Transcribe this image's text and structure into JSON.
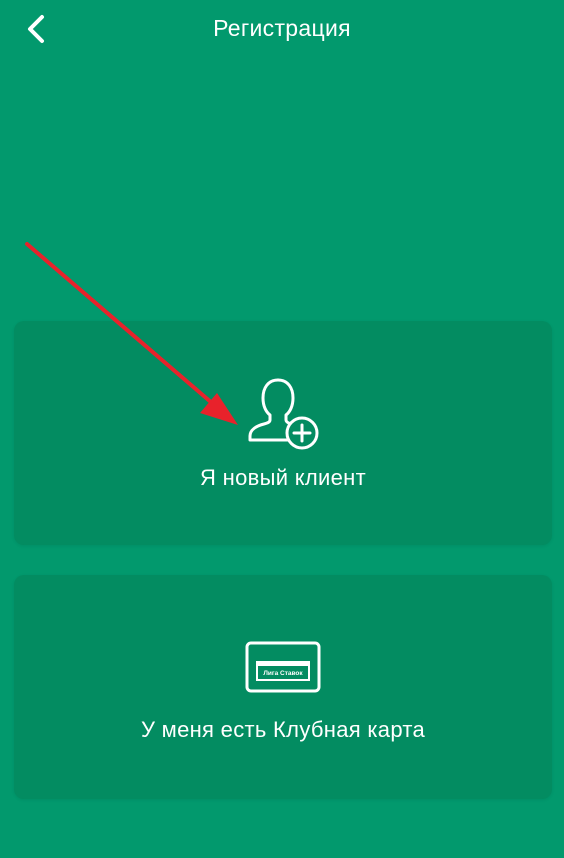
{
  "header": {
    "title": "Регистрация",
    "back_icon": "chevron-left-icon"
  },
  "options": [
    {
      "label": "Я новый клиент",
      "icon": "user-add-icon"
    },
    {
      "label": "У меня есть Клубная карта",
      "icon": "club-card-icon",
      "card_text": "Лига Ставок"
    }
  ],
  "colors": {
    "background": "#02996d",
    "card": "#038c61",
    "text": "#ffffff",
    "annotation_arrow": "#e8222b"
  },
  "annotation": {
    "icon": "red-arrow-icon"
  }
}
